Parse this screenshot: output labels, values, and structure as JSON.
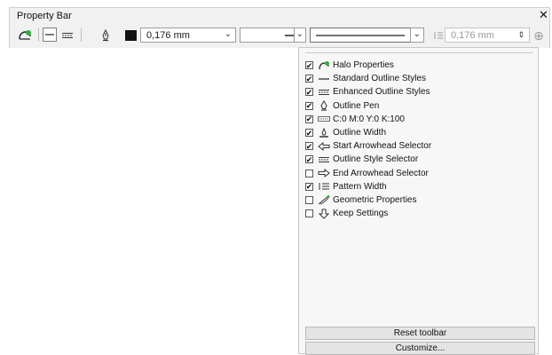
{
  "panel": {
    "title": "Property Bar",
    "close_label": "✕"
  },
  "toolbar": {
    "halo_icon": "halo-icon",
    "outline_pen_icon": "outline-pen-icon",
    "color_value": "#111111",
    "width_value": "0,176 mm",
    "pattern_width_value": "0,176 mm"
  },
  "menu": {
    "items": [
      {
        "label": "Halo Properties",
        "checked": true,
        "icon": "halo-icon"
      },
      {
        "label": "Standard Outline Styles",
        "checked": true,
        "icon": "line-icon"
      },
      {
        "label": "Enhanced Outline Styles",
        "checked": true,
        "icon": "enhanced-line-icon"
      },
      {
        "label": "Outline Pen",
        "checked": true,
        "icon": "pen-nib-icon"
      },
      {
        "label": "C:0 M:0 Y:0 K:100",
        "checked": true,
        "icon": "color-swatch-icon"
      },
      {
        "label": "Outline Width",
        "checked": true,
        "icon": "outline-width-icon"
      },
      {
        "label": "Start Arrowhead Selector",
        "checked": true,
        "icon": "start-arrow-icon"
      },
      {
        "label": "Outline Style Selector",
        "checked": true,
        "icon": "outline-style-icon"
      },
      {
        "label": "End Arrowhead Selector",
        "checked": false,
        "icon": "end-arrow-icon"
      },
      {
        "label": "Pattern Width",
        "checked": true,
        "icon": "pattern-width-icon"
      },
      {
        "label": "Geometric Properties",
        "checked": false,
        "icon": "geometric-icon"
      },
      {
        "label": "Keep Settings",
        "checked": false,
        "icon": "keep-settings-icon"
      }
    ],
    "reset_label": "Reset toolbar",
    "customize_label": "Customize..."
  }
}
